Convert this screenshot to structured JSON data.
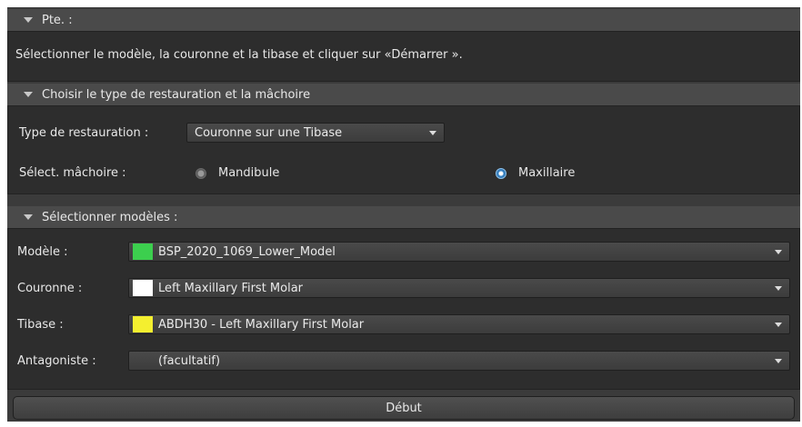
{
  "sections": {
    "info": {
      "title": "Pte. :",
      "message": "Sélectionner le modèle, la couronne et la tibase et cliquer sur «Démarrer »."
    },
    "restoration": {
      "title": "Choisir le type de restauration et la mâchoire",
      "type_label": "Type de restauration :",
      "type_value": "Couronne sur une Tibase",
      "jaw_label": "Sélect. mâchoire :",
      "jaw_options": [
        {
          "label": "Mandibule",
          "selected": false
        },
        {
          "label": "Maxillaire",
          "selected": true
        }
      ]
    },
    "models": {
      "title": "Sélectionner modèles :",
      "rows": [
        {
          "label": "Modèle :",
          "value": "BSP_2020_1069_Lower_Model",
          "swatch": "#3ccf4e"
        },
        {
          "label": "Couronne :",
          "value": "Left Maxillary First Molar",
          "swatch": "#ffffff"
        },
        {
          "label": "Tibase :",
          "value": "ABDH30 - Left Maxillary First Molar",
          "swatch": "#f4ef2f"
        },
        {
          "label": "Antagoniste :",
          "value": "(facultatif)",
          "swatch": ""
        }
      ]
    }
  },
  "start_button": "Début",
  "colors": {
    "panel_bg": "#3b3b3b",
    "header_bg": "#4a4a4a",
    "body_bg": "#2d2d2d",
    "radio_selected": "#3a86c8"
  },
  "icons": {
    "collapse": "triangle-down-icon",
    "dropdown": "chevron-down-icon"
  }
}
